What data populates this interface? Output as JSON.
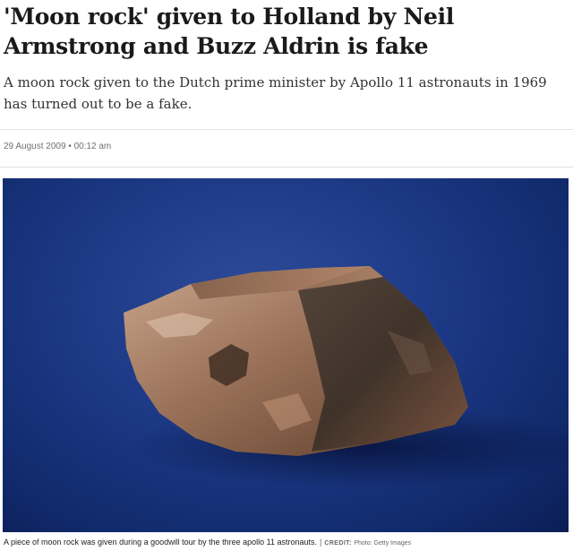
{
  "article": {
    "headline": "'Moon rock' given to Holland by Neil Armstrong and Buzz Aldrin is fake",
    "standfirst": "A moon rock given to the Dutch prime minister by Apollo 11 astronauts in 1969 has turned out to be a fake.",
    "dateline": "29 August 2009 • 00:12 am"
  },
  "image": {
    "subject": "moon-rock-photo",
    "caption": "A piece of moon rock was given during a goodwill tour by the three apollo 11 astronauts.",
    "separator": "|",
    "credit_label": "CREDIT:",
    "credit": "Photo: Getty Images"
  }
}
